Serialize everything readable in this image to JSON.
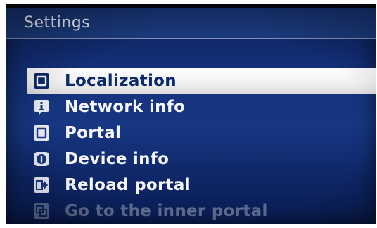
{
  "header": {
    "title": "Settings"
  },
  "menu": {
    "items": [
      {
        "label": "Localization",
        "icon": "localization-icon",
        "selected": true
      },
      {
        "label": "Network info",
        "icon": "network-info-icon",
        "selected": false
      },
      {
        "label": "Portal",
        "icon": "portal-icon",
        "selected": false
      },
      {
        "label": "Device info",
        "icon": "device-info-icon",
        "selected": false
      },
      {
        "label": "Reload portal",
        "icon": "reload-portal-icon",
        "selected": false
      },
      {
        "label": "Go to the inner portal",
        "icon": "inner-portal-icon",
        "selected": false
      }
    ]
  },
  "colors": {
    "background": "#14307a",
    "selected_background": "#f1f1f1",
    "selected_text": "#0d2a6c",
    "text": "#f4f6fc"
  }
}
